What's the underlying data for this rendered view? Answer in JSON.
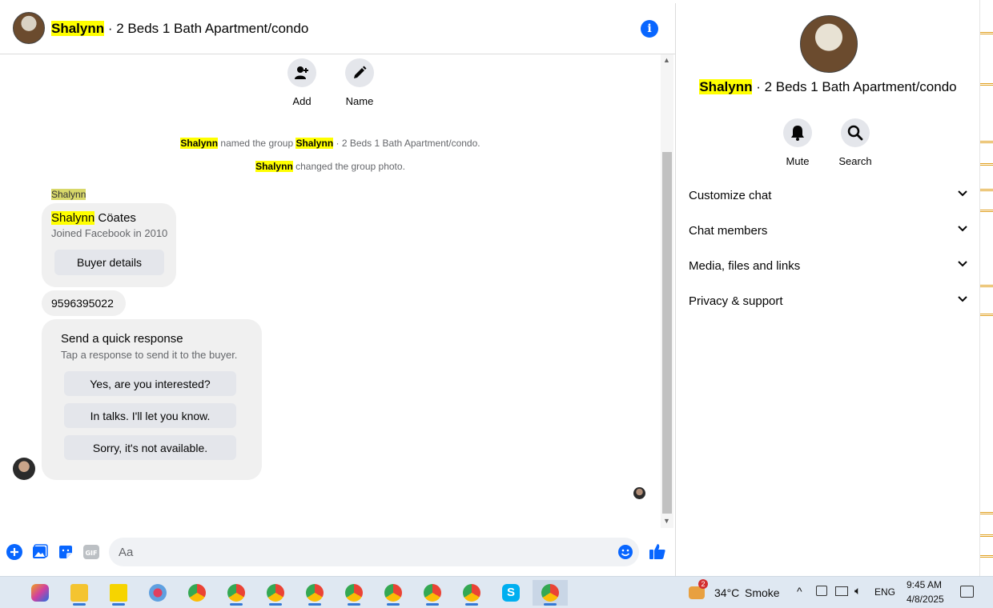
{
  "header": {
    "name_highlight": "Shalynn",
    "name_rest": " · 2 Beds 1 Bath Apartment/condo",
    "info_glyph": "i"
  },
  "group_actions": [
    {
      "label": "Add",
      "icon": "add-person-icon"
    },
    {
      "label": "Name",
      "icon": "pencil-icon"
    }
  ],
  "system_messages": {
    "m1": {
      "actor": "Shalynn",
      "text1": " named the group ",
      "group_name": "Shalynn",
      "text2": " · 2 Beds 1 Bath Apartment/condo."
    },
    "m2": {
      "actor": "Shalynn",
      "text1": " changed the group photo."
    }
  },
  "sender_label": "Shalynn",
  "buyer_card": {
    "first_name": "Shalynn",
    "last_name": " Cöates",
    "subtitle": "Joined Facebook in 2010",
    "button": "Buyer details"
  },
  "phone_message": "9596395022",
  "quick_response": {
    "title": "Send a quick response",
    "subtitle": "Tap a response to send it to the buyer.",
    "options": [
      "Yes, are you interested?",
      "In talks. I'll let you know.",
      "Sorry, it's not available."
    ]
  },
  "composer": {
    "placeholder": "Aa",
    "icons": [
      "plus-icon",
      "photo-icon",
      "sticker-icon",
      "gif-icon",
      "emoji-icon",
      "like-icon"
    ],
    "gif_label": "GIF"
  },
  "side_panel": {
    "name_highlight": "Shalynn",
    "name_rest": " · 2 Beds 1 Bath Apartment/condo",
    "actions": [
      {
        "label": "Mute",
        "icon": "bell-icon"
      },
      {
        "label": "Search",
        "icon": "search-icon"
      }
    ],
    "sections": [
      "Customize chat",
      "Chat members",
      "Media, files and links",
      "Privacy & support"
    ]
  },
  "taskbar": {
    "weather_badge": "2",
    "temperature": "34°C",
    "weather": "Smoke",
    "language": "ENG",
    "time": "9:45 AM",
    "date": "4/8/2025",
    "skype_letter": "S"
  },
  "colors": {
    "accent": "#0866ff",
    "highlight": "#ffff00",
    "bubble": "#f0f0f0",
    "button": "#e4e6eb"
  }
}
